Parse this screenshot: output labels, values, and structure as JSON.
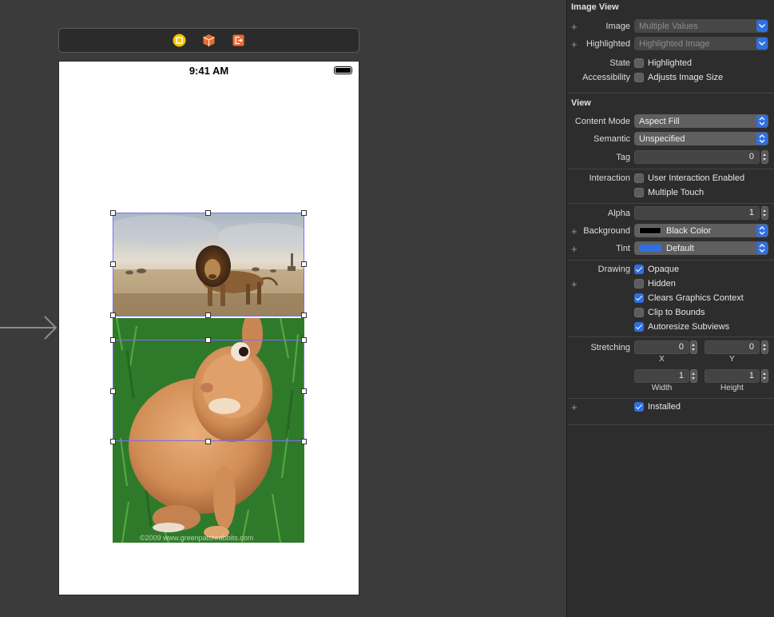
{
  "device": {
    "status_time": "9:41 AM"
  },
  "rabbit_image": {
    "watermark": "©2009 www.greenpatchrabbits.com"
  },
  "dock_icons": [
    "view-controller-icon",
    "first-responder-icon",
    "exit-icon"
  ],
  "inspector": {
    "image_view": {
      "title": "Image View",
      "image_label": "Image",
      "image_value": "Multiple Values",
      "highlighted_label": "Highlighted",
      "highlighted_value": "Highlighted Image",
      "state_label": "State",
      "state_option": "Highlighted",
      "accessibility_label": "Accessibility",
      "accessibility_option": "Adjusts Image Size"
    },
    "view": {
      "title": "View",
      "content_mode_label": "Content Mode",
      "content_mode_value": "Aspect Fill",
      "semantic_label": "Semantic",
      "semantic_value": "Unspecified",
      "tag_label": "Tag",
      "tag_value": "0",
      "interaction_label": "Interaction",
      "user_interaction": "User Interaction Enabled",
      "multiple_touch": "Multiple Touch",
      "alpha_label": "Alpha",
      "alpha_value": "1",
      "background_label": "Background",
      "background_value": "Black Color",
      "background_color": "#000000",
      "tint_label": "Tint",
      "tint_value": "Default",
      "tint_color": "#2f6fe0",
      "drawing_label": "Drawing",
      "opaque": "Opaque",
      "hidden": "Hidden",
      "clears_graphics": "Clears Graphics Context",
      "clip_to_bounds": "Clip to Bounds",
      "autoresize": "Autoresize Subviews",
      "stretching_label": "Stretching",
      "stretch_x": "0",
      "stretch_y": "0",
      "stretch_width": "1",
      "stretch_height": "1",
      "x_label": "X",
      "y_label": "Y",
      "width_label": "Width",
      "height_label": "Height",
      "installed": "Installed"
    }
  }
}
